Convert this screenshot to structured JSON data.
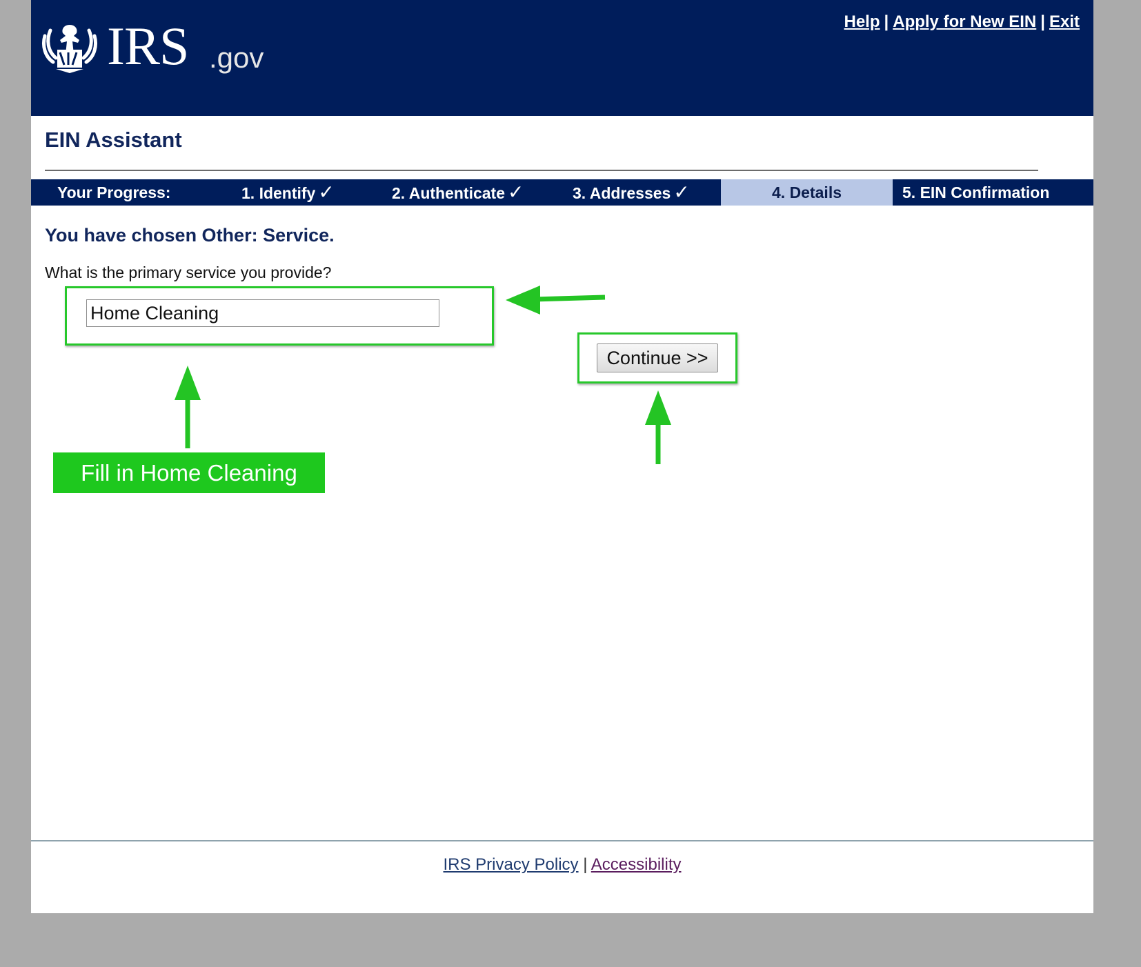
{
  "header": {
    "logo_text": "IRS",
    "logo_suffix": ".gov",
    "links": {
      "help": "Help",
      "apply": "Apply for New EIN",
      "exit": "Exit",
      "separator": "|"
    }
  },
  "app_title": "EIN Assistant",
  "progress": {
    "label": "Your Progress:",
    "steps": [
      {
        "label": "1. Identify",
        "status": "complete"
      },
      {
        "label": "2. Authenticate",
        "status": "complete"
      },
      {
        "label": "3. Addresses",
        "status": "complete"
      },
      {
        "label": "4. Details",
        "status": "current"
      },
      {
        "label": "5. EIN Confirmation",
        "status": "pending"
      }
    ],
    "check_glyph": "✓"
  },
  "form": {
    "heading": "You have chosen Other: Service.",
    "question": "What is the primary service you provide?",
    "service_value": "Home Cleaning",
    "continue_label": "Continue >>"
  },
  "annotation": {
    "callout_text": "Fill in Home Cleaning",
    "highlight_color": "#27c82b"
  },
  "footer": {
    "privacy": "IRS Privacy Policy",
    "separator": "|",
    "accessibility": "Accessibility"
  },
  "colors": {
    "header_bg": "#001d5b",
    "active_step_bg": "#b8c7e6",
    "page_bg": "#ababab"
  }
}
